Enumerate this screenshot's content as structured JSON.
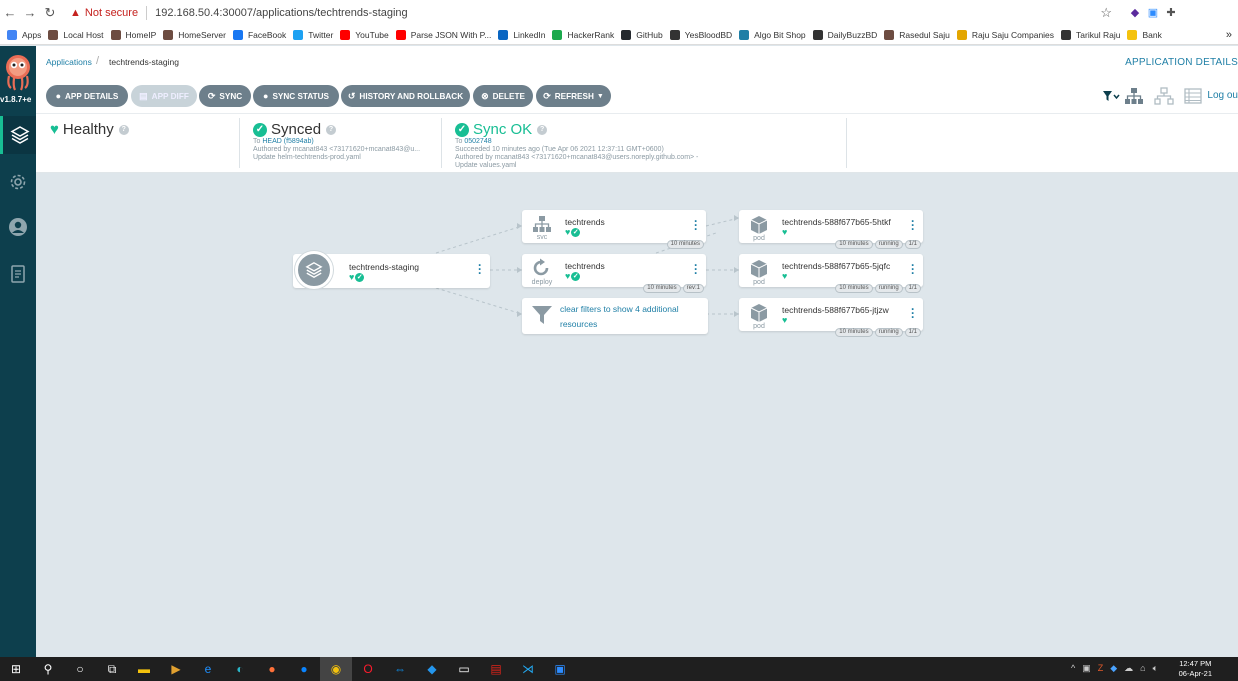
{
  "browser": {
    "security": "Not secure",
    "url": "192.168.50.4:30007/applications/techtrends-staging",
    "bookmarks": [
      {
        "label": "Apps",
        "color": "#4285f4"
      },
      {
        "label": "Local Host",
        "color": "#6d4c41"
      },
      {
        "label": "HomeIP",
        "color": "#6d4c41"
      },
      {
        "label": "HomeServer",
        "color": "#6d4c41"
      },
      {
        "label": "FaceBook",
        "color": "#1877f2"
      },
      {
        "label": "Twitter",
        "color": "#1da1f2"
      },
      {
        "label": "YouTube",
        "color": "#ff0000"
      },
      {
        "label": "Parse JSON With P...",
        "color": "#ff0000"
      },
      {
        "label": "LinkedIn",
        "color": "#0a66c2"
      },
      {
        "label": "HackerRank",
        "color": "#1ba94c"
      },
      {
        "label": "GitHub",
        "color": "#24292e"
      },
      {
        "label": "YesBloodBD",
        "color": "#333333"
      },
      {
        "label": "Algo Bit Shop",
        "color": "#1f7fa6"
      },
      {
        "label": "DailyBuzzBD",
        "color": "#333333"
      },
      {
        "label": "Rasedul Saju",
        "color": "#6d4c41"
      },
      {
        "label": "Raju Saju Companies",
        "color": "#e3a600"
      },
      {
        "label": "Tarikul Raju",
        "color": "#333333"
      },
      {
        "label": "Bank",
        "color": "#f4c20d"
      }
    ],
    "more": "»"
  },
  "sidebar": {
    "version": "v1.8.7+e"
  },
  "topbar": {
    "breadcrumb_root": "Applications",
    "breadcrumb_sep": "/",
    "breadcrumb_current": "techtrends-staging",
    "page_label": "APPLICATION DETAILS"
  },
  "toolbar": {
    "app_details": "APP DETAILS",
    "app_diff": "APP DIFF",
    "sync": "SYNC",
    "sync_status": "SYNC STATUS",
    "history": "HISTORY AND ROLLBACK",
    "delete": "DELETE",
    "refresh": "REFRESH",
    "logout": "Log ou"
  },
  "status": {
    "health": "Healthy",
    "sync": "Synced",
    "sync_to_prefix": "To",
    "sync_to_link": "HEAD (f5894ab)",
    "sync_author": "Authored by mcanat843 <73171620+mcanat843@u...",
    "sync_message": "Update helm-techtrends-prod.yaml",
    "op": "Sync OK",
    "op_to_prefix": "To",
    "op_to_link": "0502748",
    "op_time": "Succeeded 10 minutes ago (Tue Apr 06 2021 12:37:11 GMT+0600)",
    "op_author": "Authored by mcanat843 <73171620+mcanat843@users.noreply.github.com> -",
    "op_message": "Update values.yaml"
  },
  "graph": {
    "app": {
      "name": "techtrends-staging"
    },
    "svc": {
      "name": "techtrends",
      "kind": "svc",
      "age": "10 minutes"
    },
    "deploy": {
      "name": "techtrends",
      "kind": "deploy",
      "age": "10 minutes",
      "rev": "rev:1"
    },
    "filter": {
      "text": "clear filters to show 4 additional resources"
    },
    "pods": [
      {
        "name": "techtrends-588f677b65-5htkf",
        "kind": "pod",
        "age": "10 minutes",
        "state": "running",
        "ready": "1/1"
      },
      {
        "name": "techtrends-588f677b65-5jqfc",
        "kind": "pod",
        "age": "10 minutes",
        "state": "running",
        "ready": "1/1"
      },
      {
        "name": "techtrends-588f677b65-jtjzw",
        "kind": "pod",
        "age": "10 minutes",
        "state": "running",
        "ready": "1/1"
      }
    ]
  },
  "taskbar": {
    "time": "12:47 PM",
    "date": "06-Apr-21"
  },
  "colors": {
    "sidebar": "#0d3f4d",
    "accent": "#18be94",
    "link": "#1f7fa6",
    "button": "#6d7f8b"
  }
}
